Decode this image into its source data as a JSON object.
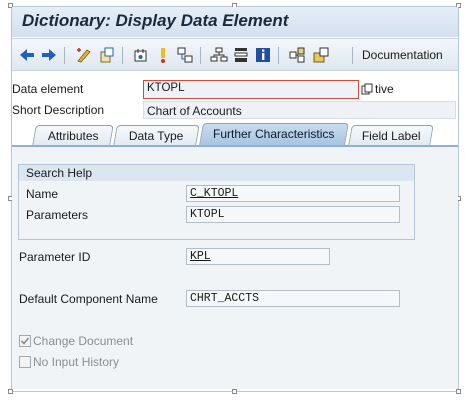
{
  "title": "Dictionary: Display Data Element",
  "toolbar": {
    "icons": [
      "back-arrow-icon",
      "forward-arrow-icon",
      "display-change-icon",
      "other-object-icon",
      "activate-icon",
      "check-icon",
      "where-used-icon",
      "object-list-icon",
      "navigation-window-icon",
      "info-icon",
      "hierarchy-icon",
      "transport-icon"
    ],
    "documentation_label": "Documentation"
  },
  "header": {
    "data_element_label": "Data element",
    "data_element_value": "KTOPL",
    "status_suffix": "tive",
    "short_description_label": "Short Description",
    "short_description_value": "Chart of Accounts"
  },
  "tabs": [
    {
      "label": "Attributes",
      "active": false
    },
    {
      "label": "Data Type",
      "active": false
    },
    {
      "label": "Further Characteristics",
      "active": true
    },
    {
      "label": "Field Label",
      "active": false
    }
  ],
  "search_help": {
    "title": "Search Help",
    "name_label": "Name",
    "name_value": "C_KTOPL",
    "parameters_label": "Parameters",
    "parameters_value": "KTOPL"
  },
  "parameter_id": {
    "label": "Parameter ID",
    "value": "KPL"
  },
  "default_component": {
    "label": "Default Component Name",
    "value": "CHRT_ACCTS"
  },
  "checkboxes": {
    "change_document": {
      "label": "Change Document",
      "checked": true
    },
    "no_input_history": {
      "label": "No Input History",
      "checked": false
    }
  },
  "colors": {
    "accent": "#a8c4e0",
    "key_border": "#d24a3a",
    "toolbar_blue": "#1f5fbf"
  }
}
